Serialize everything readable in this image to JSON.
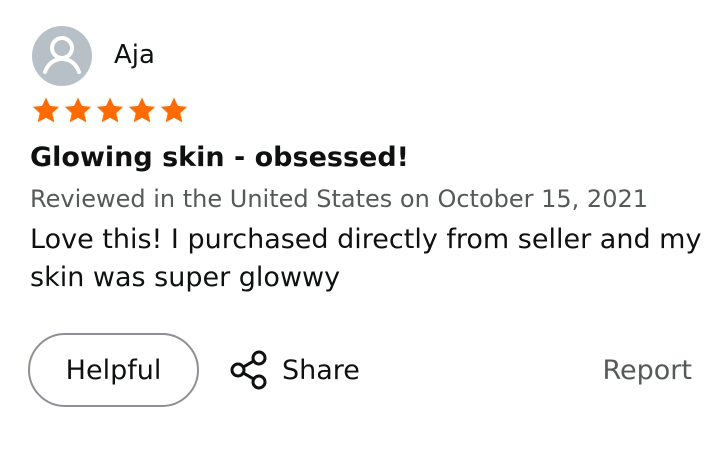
{
  "reviewer": {
    "name": "Aja",
    "avatar_icon": "user-avatar-icon"
  },
  "rating": {
    "stars": 5,
    "max_stars": 5,
    "color": "#ff6b00"
  },
  "review": {
    "title": "Glowing skin - obsessed!",
    "meta": "Reviewed in the United States on October 15, 2021",
    "body": "Love this! I purchased directly from seller and my skin was super glowwy"
  },
  "actions": {
    "helpful_label": "Helpful",
    "share_label": "Share",
    "share_icon": "share-icon",
    "report_label": "Report"
  },
  "colors": {
    "text": "#0f1111",
    "muted": "#565959",
    "avatar_bg": "#b7c0c7",
    "button_border": "#8d9096"
  }
}
